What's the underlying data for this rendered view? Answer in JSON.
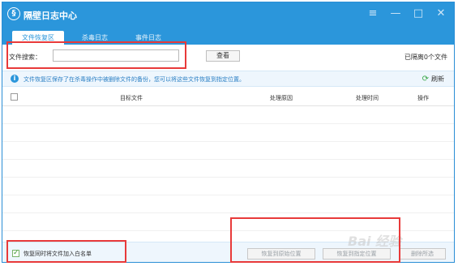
{
  "window": {
    "title": "隔壁日志中心",
    "logo_glyph": "§",
    "controls": [
      "≡",
      "—",
      "□",
      "✕"
    ]
  },
  "tabs": [
    {
      "label": "文件恢复区",
      "active": true
    },
    {
      "label": "杀毒日志",
      "active": false
    },
    {
      "label": "事件日志",
      "active": false
    }
  ],
  "search": {
    "label": "文件搜索：",
    "value": "",
    "placeholder": "",
    "button_label": "查看",
    "isolated_count_text": "已隔离0个文件"
  },
  "info": {
    "icon": "info-icon",
    "text": "文件恢复区保存了在杀毒操作中被删除文件的备份，您可以将这些文件恢复到指定位置。",
    "refresh_label": "刷新",
    "refresh_icon": "refresh-icon"
  },
  "table": {
    "columns": [
      "目标文件",
      "处理原因",
      "处理时间",
      "操作"
    ],
    "rows": []
  },
  "footer": {
    "whitelist_label": "恢复同时将文件加入白名单",
    "whitelist_checked": true,
    "buttons": [
      "恢复到原始位置",
      "恢复到指定位置",
      "删除所选"
    ]
  },
  "watermark": "Bai 经验",
  "colors": {
    "accent": "#2b96db",
    "highlight_box": "#e83a3a"
  }
}
